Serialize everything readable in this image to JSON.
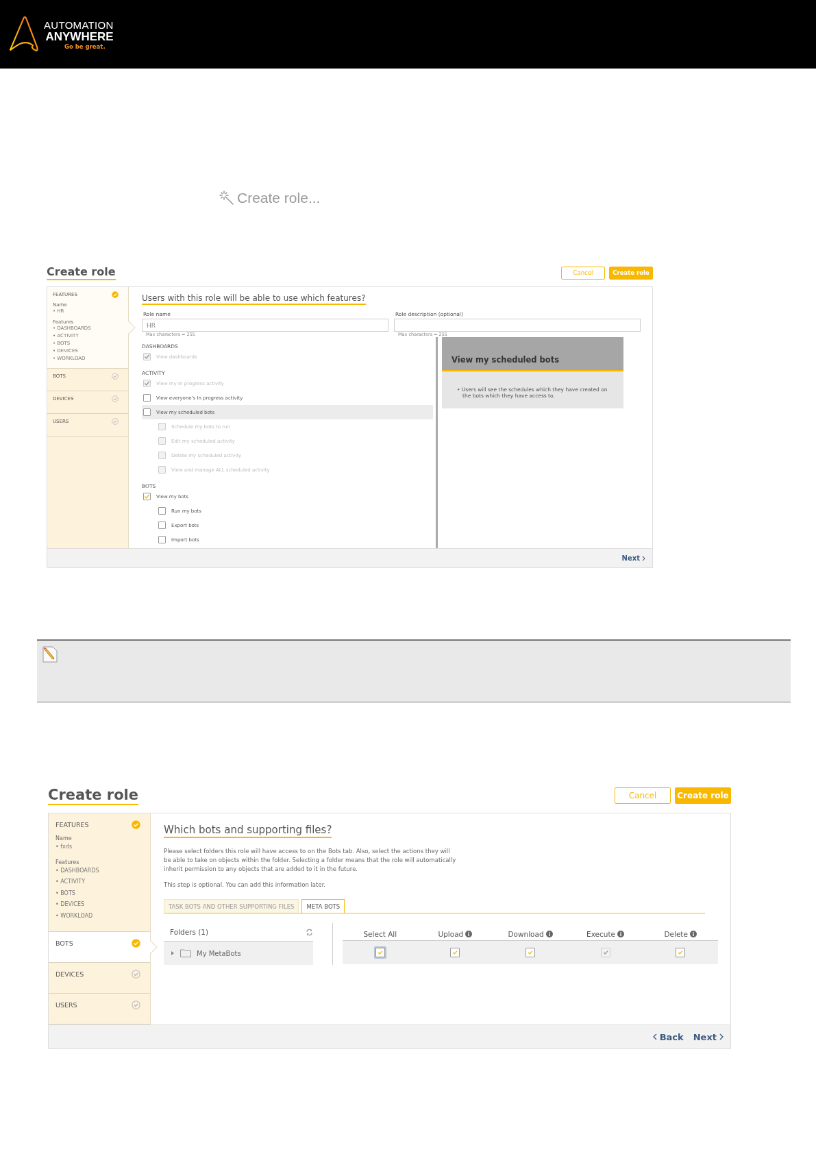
{
  "header": {
    "logo": {
      "line1": "AUTOMATION",
      "line2": "ANYWHERE",
      "tagline": "Go be great."
    }
  },
  "step_heading": "Create role...",
  "screen_features": {
    "title": "Create role",
    "buttons": [
      {
        "label": "Cancel",
        "kind": "secondary"
      },
      {
        "label": "Create role",
        "kind": "primary"
      }
    ],
    "sidebar": [
      {
        "label": "FEATURES",
        "selected": true,
        "done": true,
        "details": [
          {
            "label": "Name",
            "items": [
              "• HR"
            ]
          },
          {
            "label": "Features",
            "items": [
              "• DASHBOARDS",
              "• ACTIVITY",
              "• BOTS",
              "• DEVICES",
              "• WORKLOAD"
            ]
          }
        ]
      },
      {
        "label": "BOTS",
        "selected": false,
        "done": false
      },
      {
        "label": "DEVICES",
        "selected": false,
        "done": false
      },
      {
        "label": "USERS",
        "selected": false,
        "done": false
      }
    ],
    "question": "Users with this role will be able to use which features?",
    "fields": [
      {
        "label": "Role name",
        "value": "HR",
        "hint": "Max characters = 255"
      },
      {
        "label": "Role description (optional)",
        "hint": "Max characters = 255"
      }
    ],
    "groups": [
      {
        "heading": "DASHBOARDS",
        "options": [
          {
            "label": "View dashboards",
            "checked": true,
            "disabled": true,
            "selected": false
          }
        ]
      },
      {
        "heading": "ACTIVITY",
        "options": [
          {
            "label": "View my In progress activity",
            "checked": true,
            "disabled": true,
            "selected": false
          },
          {
            "label": "View everyone's In progress activity",
            "checked": false,
            "disabled": false,
            "selected": false
          },
          {
            "label": "View my scheduled bots",
            "checked": false,
            "disabled": false,
            "selected": true,
            "children": [
              {
                "label": "Schedule my bots to run",
                "checked": false,
                "disabled": true
              },
              {
                "label": "Edit my scheduled activity",
                "checked": false,
                "disabled": true
              },
              {
                "label": "Delete my scheduled activity",
                "checked": false,
                "disabled": true
              },
              {
                "label": "View and manage ALL scheduled activity",
                "checked": false,
                "disabled": true
              }
            ]
          }
        ]
      },
      {
        "heading": "BOTS",
        "options": [
          {
            "label": "View my bots",
            "checked": true,
            "disabled": false,
            "selected": false,
            "children": [
              {
                "label": "Run my bots",
                "checked": false,
                "disabled": false
              },
              {
                "label": "Export bots",
                "checked": false,
                "disabled": false
              },
              {
                "label": "Import bots",
                "checked": false,
                "disabled": false
              }
            ]
          }
        ]
      }
    ],
    "info": {
      "title": "View my scheduled bots",
      "bullets": [
        "• Users will see the schedules which they have created on the bots which they have access to."
      ]
    },
    "footer": {
      "next": "Next"
    }
  },
  "note": {
    "kind": "edit"
  },
  "screen_bots": {
    "title": "Create role",
    "buttons": [
      {
        "label": "Cancel",
        "kind": "secondary"
      },
      {
        "label": "Create role",
        "kind": "primary"
      }
    ],
    "sidebar": [
      {
        "label": "FEATURES",
        "selected": false,
        "done": true,
        "details": [
          {
            "label": "Name",
            "items": [
              "• fxds"
            ]
          },
          {
            "label": "Features",
            "items": [
              "• DASHBOARDS",
              "• ACTIVITY",
              "• BOTS",
              "• DEVICES",
              "• WORKLOAD"
            ]
          }
        ]
      },
      {
        "label": "BOTS",
        "selected": true,
        "done": true
      },
      {
        "label": "DEVICES",
        "selected": false,
        "done": false
      },
      {
        "label": "USERS",
        "selected": false,
        "done": false
      }
    ],
    "question": "Which bots and supporting files?",
    "paragraphs": [
      "Please select folders this role will have access to on the Bots tab. Also, select the actions they will be able to take on objects within the folder. Selecting a folder means that the role will automatically inherit permission to any objects that are added to it in the future.",
      "This step is optional. You can add this information later."
    ],
    "tabs": [
      {
        "label": "TASK BOTS AND OTHER SUPPORTING FILES",
        "selected": false
      },
      {
        "label": "META BOTS",
        "selected": true
      }
    ],
    "folders": {
      "heading": "Folders (1)",
      "items": [
        {
          "name": "My MetaBots",
          "expanded": false
        }
      ]
    },
    "permissions": [
      {
        "label": "Select All",
        "info": false,
        "checked": true,
        "disabled": false,
        "focused": true
      },
      {
        "label": "Upload",
        "info": true,
        "checked": true,
        "disabled": false,
        "focused": false
      },
      {
        "label": "Download",
        "info": true,
        "checked": true,
        "disabled": false,
        "focused": false
      },
      {
        "label": "Execute",
        "info": true,
        "checked": true,
        "disabled": true,
        "focused": false
      },
      {
        "label": "Delete",
        "info": true,
        "checked": true,
        "disabled": false,
        "focused": false
      }
    ],
    "footer": {
      "back": "Back",
      "next": "Next"
    }
  }
}
